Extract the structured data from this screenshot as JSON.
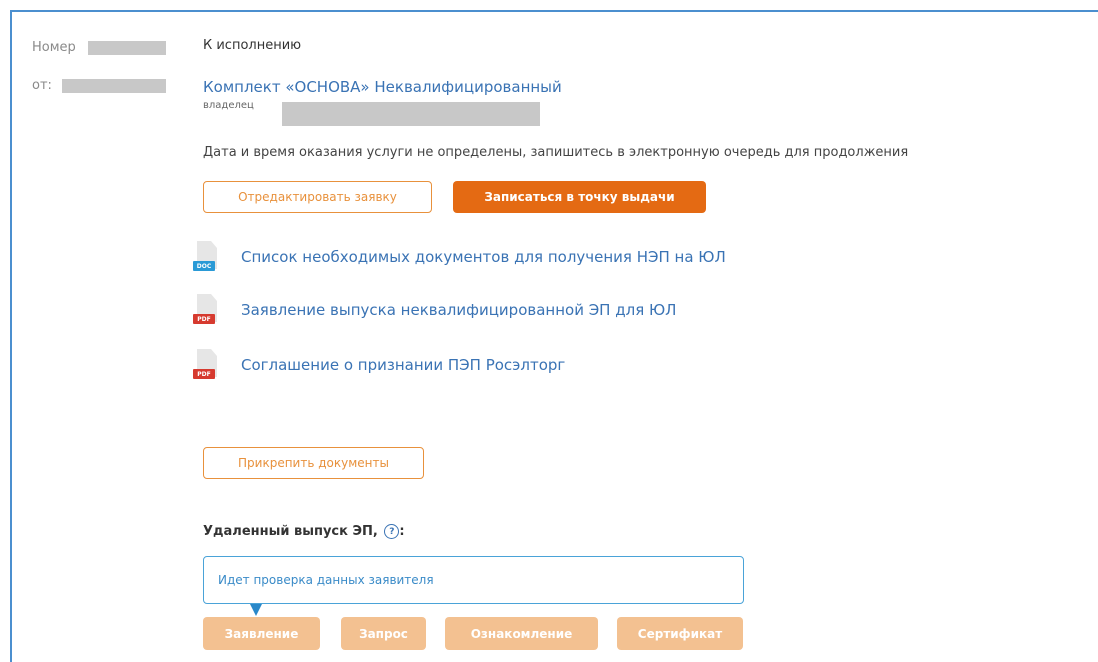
{
  "meta": {
    "number_label": "Номер",
    "from_label": "от"
  },
  "status": "К исполнению",
  "product": {
    "title": "Комплект «ОСНОВА» Неквалифицированный",
    "owner_label": "владелец"
  },
  "info_text": "Дата и время оказания услуги не определены, запишитесь в электронную очередь для продолжения",
  "buttons": {
    "edit": "Отредактировать заявку",
    "book": "Записаться в точку выдачи",
    "attach": "Прикрепить документы"
  },
  "documents": [
    {
      "type": "DOC",
      "label": "Список необходимых документов для получения НЭП на ЮЛ",
      "icon": "doc-file-icon"
    },
    {
      "type": "PDF",
      "label": "Заявление выпуска неквалифицированной ЭП для ЮЛ",
      "icon": "pdf-file-icon"
    },
    {
      "type": "PDF",
      "label": "Соглашение о признании ПЭП Росэлторг",
      "icon": "pdf-file-icon"
    }
  ],
  "remote": {
    "heading": "Удаленный выпуск ЭП,",
    "help_glyph": "?",
    "colon": ":",
    "status_text": "Идет проверка данных заявителя",
    "steps": [
      "Заявление",
      "Запрос",
      "Ознакомление",
      "Сертификат"
    ]
  },
  "colors": {
    "accent": "#e46a13",
    "link": "#3a73b4",
    "doc": "#2a9ad6",
    "pdf": "#d63a2f"
  }
}
